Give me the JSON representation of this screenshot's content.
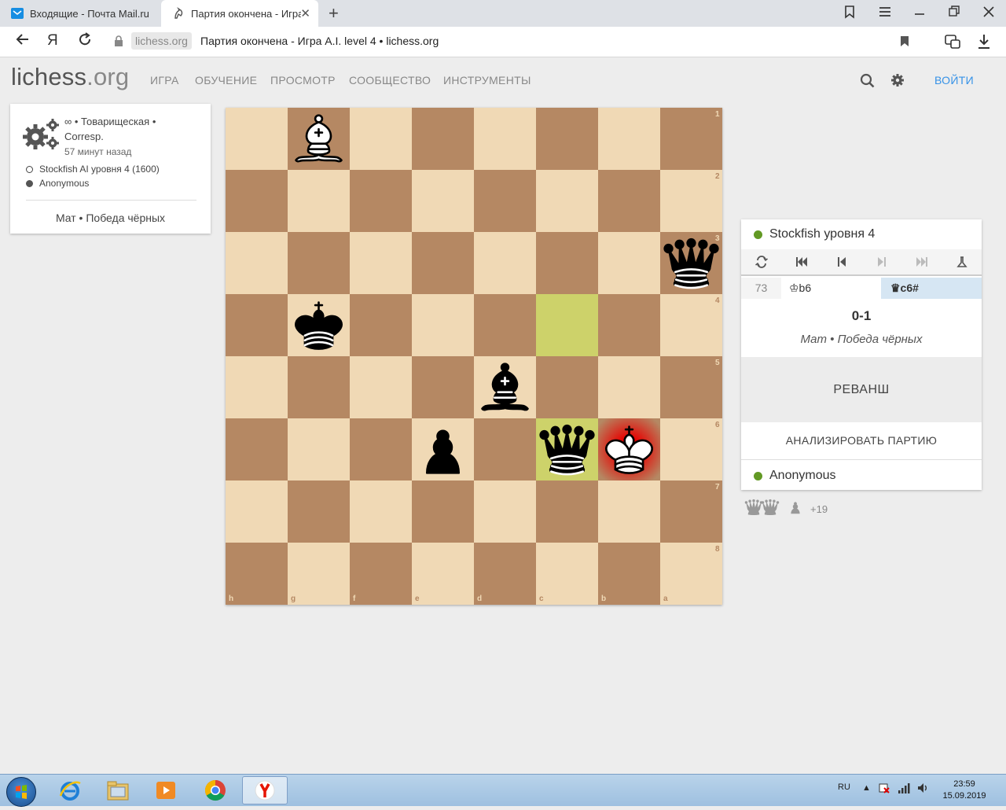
{
  "browser": {
    "tabs": [
      {
        "title": "Входящие - Почта Mail.ru",
        "active": false
      },
      {
        "title": "Партия окончена - Игра A.I. level 4 • lichess.org",
        "active": true
      }
    ],
    "domain_chip": "lichess.org",
    "page_title": "Партия окончена - Игра A.I. level 4 • lichess.org"
  },
  "site": {
    "logo_main": "lichess",
    "logo_suffix": ".org",
    "nav": [
      "ИГРА",
      "ОБУЧЕНИЕ",
      "ПРОСМОТР",
      "СООБЩЕСТВО",
      "ИНСТРУМЕНТЫ"
    ],
    "login": "ВОЙТИ"
  },
  "game_info": {
    "line1": "∞ • Товарищеская •",
    "line2": "Corresp.",
    "time_ago": "57 минут назад",
    "white_player": "Stockfish AI уровня 4 (1600)",
    "black_player": "Anonymous",
    "status": "Мат • Победа чёрных"
  },
  "board": {
    "ranks": [
      "1",
      "2",
      "3",
      "4",
      "5",
      "6",
      "7",
      "8"
    ],
    "files": [
      "h",
      "g",
      "f",
      "e",
      "d",
      "c",
      "b",
      "a"
    ],
    "pieces": [
      {
        "square": "g1",
        "piece": "white-bishop"
      },
      {
        "square": "a3",
        "piece": "black-queen"
      },
      {
        "square": "g4",
        "piece": "black-king"
      },
      {
        "square": "d5",
        "piece": "black-bishop"
      },
      {
        "square": "e6",
        "piece": "black-pawn"
      },
      {
        "square": "c6",
        "piece": "black-queen"
      },
      {
        "square": "b6",
        "piece": "white-king"
      }
    ],
    "last_move_squares": [
      "c4",
      "c6"
    ],
    "check_square": "b6"
  },
  "panel": {
    "top_player": "Stockfish уровня 4",
    "move_number": "73",
    "white_move": "♔b6",
    "black_move": "♛c6#",
    "result": "0-1",
    "result_text": "Мат • Победа чёрных",
    "rematch": "РЕВАНШ",
    "analyse": "АНАЛИЗИРОВАТЬ ПАРТИЮ",
    "bottom_player": "Anonymous",
    "material_diff": "+19"
  },
  "taskbar": {
    "language": "RU",
    "time": "23:59",
    "date": "15.09.2019"
  }
}
